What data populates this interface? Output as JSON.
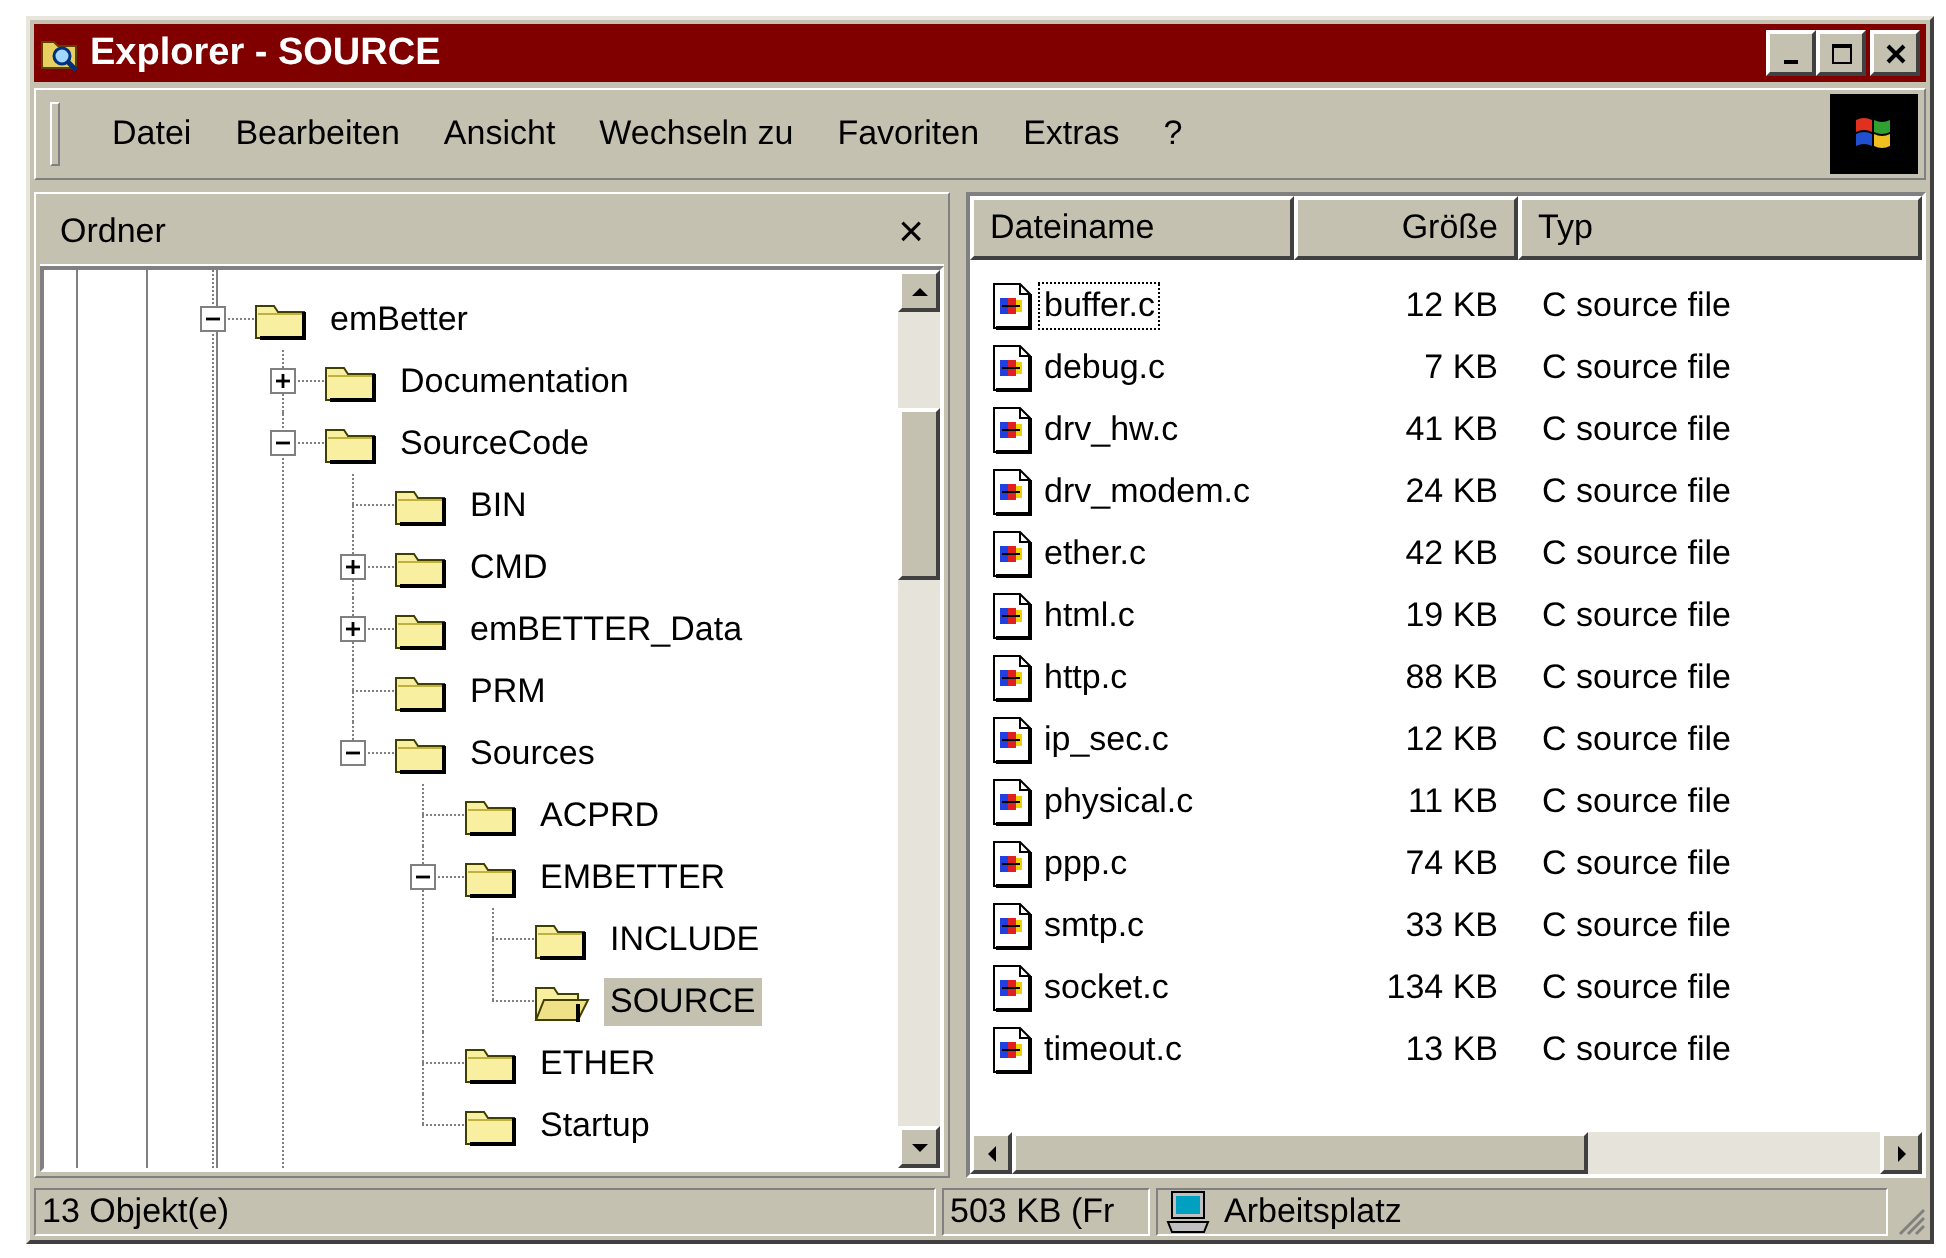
{
  "window": {
    "title": "Explorer - SOURCE"
  },
  "menu": [
    {
      "label": "Datei"
    },
    {
      "label": "Bearbeiten"
    },
    {
      "label": "Ansicht"
    },
    {
      "label": "Wechseln zu"
    },
    {
      "label": "Favoriten"
    },
    {
      "label": "Extras"
    },
    {
      "label": "?"
    }
  ],
  "folder_pane": {
    "title": "Ordner",
    "close": "×",
    "tree": [
      {
        "label": "emBetter",
        "expanded": true,
        "selected": false,
        "children": [
          {
            "label": "Documentation",
            "expanded": false,
            "selected": false
          },
          {
            "label": "SourceCode",
            "expanded": true,
            "selected": false,
            "children": [
              {
                "label": "BIN",
                "selected": false
              },
              {
                "label": "CMD",
                "expanded": false,
                "selected": false
              },
              {
                "label": "emBETTER_Data",
                "expanded": false,
                "selected": false
              },
              {
                "label": "PRM",
                "selected": false
              },
              {
                "label": "Sources",
                "expanded": true,
                "selected": false,
                "children": [
                  {
                    "label": "ACPRD",
                    "selected": false
                  },
                  {
                    "label": "EMBETTER",
                    "expanded": true,
                    "selected": false,
                    "children": [
                      {
                        "label": "INCLUDE",
                        "selected": false
                      },
                      {
                        "label": "SOURCE",
                        "selected": true
                      }
                    ]
                  },
                  {
                    "label": "ETHER",
                    "selected": false
                  },
                  {
                    "label": "Startup",
                    "selected": false
                  }
                ]
              }
            ]
          }
        ]
      }
    ]
  },
  "file_list": {
    "columns": [
      {
        "label": "Dateiname"
      },
      {
        "label": "Größe"
      },
      {
        "label": "Typ"
      }
    ],
    "rows": [
      {
        "name": "buffer.c",
        "size": "12 KB",
        "type": "C source file",
        "focused": true
      },
      {
        "name": "debug.c",
        "size": "7 KB",
        "type": "C source file",
        "focused": false
      },
      {
        "name": "drv_hw.c",
        "size": "41 KB",
        "type": "C source file",
        "focused": false
      },
      {
        "name": "drv_modem.c",
        "size": "24 KB",
        "type": "C source file",
        "focused": false
      },
      {
        "name": "ether.c",
        "size": "42 KB",
        "type": "C source file",
        "focused": false
      },
      {
        "name": "html.c",
        "size": "19 KB",
        "type": "C source file",
        "focused": false
      },
      {
        "name": "http.c",
        "size": "88 KB",
        "type": "C source file",
        "focused": false
      },
      {
        "name": "ip_sec.c",
        "size": "12 KB",
        "type": "C source file",
        "focused": false
      },
      {
        "name": "physical.c",
        "size": "11 KB",
        "type": "C source file",
        "focused": false
      },
      {
        "name": "ppp.c",
        "size": "74 KB",
        "type": "C source file",
        "focused": false
      },
      {
        "name": "smtp.c",
        "size": "33 KB",
        "type": "C source file",
        "focused": false
      },
      {
        "name": "socket.c",
        "size": "134 KB",
        "type": "C source file",
        "focused": false
      },
      {
        "name": "timeout.c",
        "size": "13 KB",
        "type": "C source file",
        "focused": false
      }
    ]
  },
  "status_bar": {
    "objects": "13 Objekt(e)",
    "size": "503 KB (Fr",
    "location": "Arbeitsplatz"
  }
}
